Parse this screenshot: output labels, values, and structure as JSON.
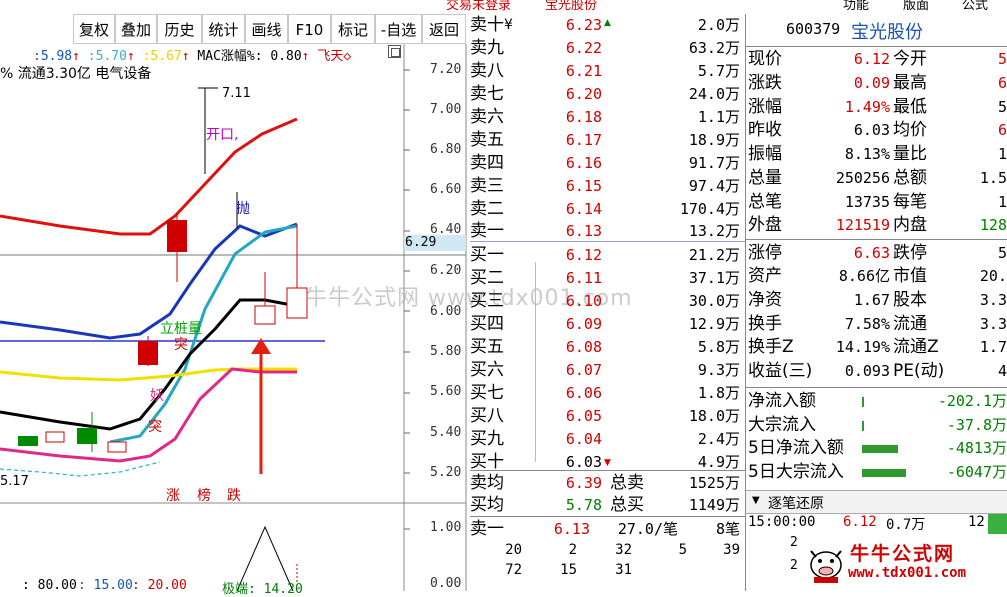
{
  "top_strip": {
    "left": "交易未登录",
    "middle": "宝光股份",
    "right1": "功能",
    "right2": "版面",
    "right3": "公式"
  },
  "toolbar": [
    "复权",
    "叠加",
    "历史",
    "统计",
    "画线",
    "F10",
    "标记",
    "-自选",
    "返回"
  ],
  "chart": {
    "ma_label_prefix": ":",
    "ma1": "5.98",
    "ma2": "5.70",
    "ma3": "5.67",
    "macd_label": "MAC涨幅%: 0.80",
    "flag_label": "飞天◇",
    "info_line": "% 流通3.30亿 电气设备",
    "current_price_tag": "6.29",
    "high_marker": "7.11",
    "low_marker": "5.17",
    "annotations": {
      "kaikou": "开口,",
      "pao": "抛",
      "liqi": "立桩量",
      "tu1": "突",
      "yao": "妖",
      "tu2": "突"
    },
    "bottom_tags": [
      "涨",
      "榜",
      "跌"
    ],
    "price_ticks": [
      "7.20",
      "7.00",
      "6.80",
      "6.60",
      "6.40",
      "6.20",
      "6.00",
      "5.80",
      "5.60",
      "5.40",
      "5.20"
    ],
    "sub_ticks": [
      "1.00",
      "0.00"
    ],
    "sub_legend": [
      ": 80.00",
      ": 15.00",
      ": 20.00",
      "极端: 14.20"
    ],
    "watermark": "牛牛公式网 www.tdx001.com"
  },
  "order_book": {
    "asks": [
      {
        "label": "卖十",
        "suffix": "¥",
        "price": "6.23",
        "flag": "▲",
        "vol": "2.0万"
      },
      {
        "label": "卖九",
        "price": "6.22",
        "vol": "63.2万"
      },
      {
        "label": "卖八",
        "price": "6.21",
        "vol": "5.7万"
      },
      {
        "label": "卖七",
        "price": "6.20",
        "vol": "24.0万"
      },
      {
        "label": "卖六",
        "price": "6.18",
        "vol": "1.1万"
      },
      {
        "label": "卖五",
        "price": "6.17",
        "vol": "18.9万"
      },
      {
        "label": "卖四",
        "price": "6.16",
        "vol": "91.7万"
      },
      {
        "label": "卖三",
        "price": "6.15",
        "vol": "97.4万"
      },
      {
        "label": "卖二",
        "price": "6.14",
        "vol": "170.4万"
      },
      {
        "label": "卖一",
        "price": "6.13",
        "vol": "13.2万"
      }
    ],
    "bids": [
      {
        "label": "买一",
        "price": "6.12",
        "vol": "21.2万"
      },
      {
        "label": "买二",
        "price": "6.11",
        "vol": "37.1万"
      },
      {
        "label": "买三",
        "price": "6.10",
        "vol": "30.0万"
      },
      {
        "label": "买四",
        "price": "6.09",
        "vol": "12.9万"
      },
      {
        "label": "买五",
        "price": "6.08",
        "vol": "5.8万"
      },
      {
        "label": "买六",
        "price": "6.07",
        "vol": "9.3万"
      },
      {
        "label": "买七",
        "price": "6.06",
        "vol": "1.8万"
      },
      {
        "label": "买八",
        "price": "6.05",
        "vol": "18.0万"
      },
      {
        "label": "买九",
        "price": "6.04",
        "vol": "2.4万"
      },
      {
        "label": "买十",
        "price": "6.03",
        "flag": "▼",
        "vol": "4.9万"
      }
    ],
    "avg_sell": {
      "label": "卖均",
      "price": "6.39",
      "label2": "总卖",
      "vol": "1525万"
    },
    "avg_buy": {
      "label": "买均",
      "price": "5.78",
      "label2": "总买",
      "vol": "1149万"
    },
    "sell1": {
      "label": "卖一",
      "price": "6.13",
      "mid": "27.0/笔",
      "right": "8笔"
    },
    "queue_row1": [
      "20",
      "2",
      "32",
      "5",
      "39"
    ],
    "queue_row2": [
      "72",
      "15",
      "31"
    ]
  },
  "quote": {
    "code": "600379",
    "name": "宝光股份",
    "rows": [
      {
        "l1": "现价",
        "v1": "6.12",
        "c1": "red",
        "l2": "今开",
        "v2": "5"
      },
      {
        "l1": "涨跌",
        "v1": "0.09",
        "c1": "red",
        "l2": "最高",
        "v2": "6"
      },
      {
        "l1": "涨幅",
        "v1": "1.49%",
        "c1": "red",
        "l2": "最低",
        "v2": "5"
      },
      {
        "l1": "昨收",
        "v1": "6.03",
        "c1": "black",
        "l2": "均价",
        "v2": "6"
      },
      {
        "l1": "振幅",
        "v1": "8.13%",
        "c1": "black",
        "l2": "量比",
        "v2": "1"
      },
      {
        "l1": "总量",
        "v1": "250256",
        "c1": "black",
        "l2": "总额",
        "v2": "1.5"
      },
      {
        "l1": "总笔",
        "v1": "13735",
        "c1": "black",
        "l2": "每笔",
        "v2": "1"
      },
      {
        "l1": "外盘",
        "v1": "121519",
        "c1": "red",
        "l2": "内盘",
        "v2": "128"
      },
      {
        "l1": "涨停",
        "v1": "6.63",
        "c1": "red",
        "l2": "跌停",
        "v2": "5"
      },
      {
        "l1": "资产",
        "v1": "8.66亿",
        "c1": "black",
        "l2": "市值",
        "v2": "20."
      },
      {
        "l1": "净资",
        "v1": "1.67",
        "c1": "black",
        "l2": "股本",
        "v2": "3.3"
      },
      {
        "l1": "换手",
        "v1": "7.58%",
        "c1": "black",
        "l2": "流通",
        "v2": "3.3"
      },
      {
        "l1": "换手Z",
        "v1": "14.19%",
        "c1": "black",
        "l2": "流通Z",
        "v2": "1.7"
      },
      {
        "l1": "收益(三)",
        "v1": "0.093",
        "c1": "black",
        "l2": "PE(动)",
        "v2": "4"
      }
    ],
    "flows": [
      {
        "label": "净流入额",
        "value": "-202.1万"
      },
      {
        "label": "大宗流入",
        "value": "-37.8万"
      },
      {
        "label": "5日净流入额",
        "value": "-4813万"
      },
      {
        "label": "5日大宗流入",
        "value": "-6047万"
      }
    ],
    "tick_header": "逐笔还原",
    "tick_row": {
      "time": "15:00:00",
      "price": "6.12",
      "vol": "0.7万",
      "num": "12"
    },
    "tick_prefix": [
      "2",
      "2"
    ],
    "logo_text": "牛牛公式网",
    "logo_url": "www.tdx001.com"
  },
  "colors": {
    "up": "#d00000",
    "down": "#008000",
    "blue": "#1a52b0"
  }
}
